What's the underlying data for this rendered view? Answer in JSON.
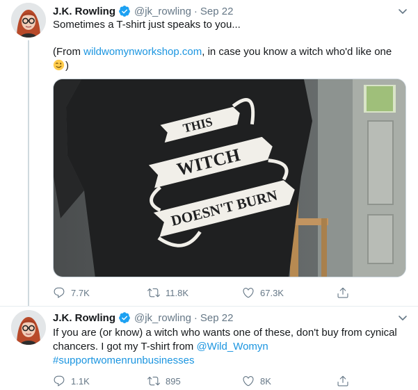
{
  "tweets": [
    {
      "author": {
        "name": "J.K. Rowling",
        "handle": "@jk_rowling"
      },
      "separator": "·",
      "date": "Sep 22",
      "text_line1": "Sometimes a T-shirt just speaks to you...",
      "text_prefix": "(From ",
      "link": "wildwomynworkshop.com",
      "text_suffix": ", in case you know a witch who'd like one",
      "text_end": ")",
      "media": {
        "shirt_text": [
          "THIS",
          "WITCH",
          "DOESN'T BURN"
        ]
      },
      "actions": {
        "replies": "7.7K",
        "retweets": "11.8K",
        "likes": "67.3K"
      }
    },
    {
      "author": {
        "name": "J.K. Rowling",
        "handle": "@jk_rowling"
      },
      "separator": "·",
      "date": "Sep 22",
      "text_part1": "If you are (or know) a witch who wants one of these, don't buy from cynical chancers. I got my T-shirt from ",
      "mention": "@Wild_Womyn",
      "hashtag": "#supportwomenrunbusinesses",
      "actions": {
        "replies": "1.1K",
        "retweets": "895",
        "likes": "8K"
      }
    }
  ],
  "colors": {
    "link": "#1b95e0",
    "muted": "#657786",
    "verified": "#1da1f2"
  },
  "icons": [
    "verified-badge-icon",
    "chevron-down-icon",
    "reply-icon",
    "retweet-icon",
    "like-icon",
    "share-icon",
    "winking-face-emoji"
  ]
}
